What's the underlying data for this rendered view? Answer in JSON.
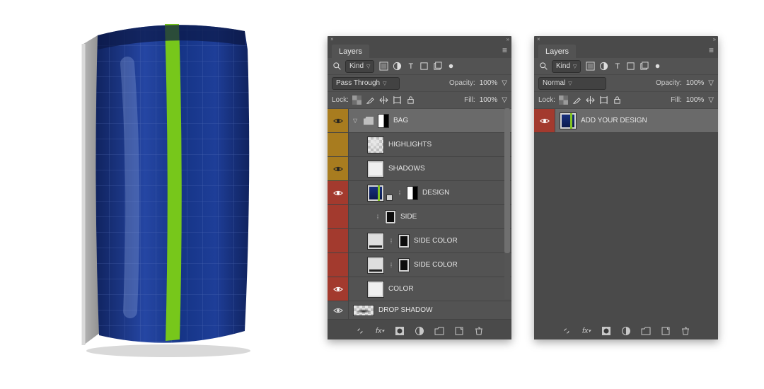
{
  "panel_title": "Layers",
  "filter": {
    "search_placeholder": "Kind",
    "opacity_label": "Opacity:",
    "opacity_value": "100%",
    "lock_label": "Lock:",
    "fill_label": "Fill:",
    "fill_value": "100%"
  },
  "blend_modes": {
    "a": "Pass Through",
    "b": "Normal"
  },
  "left_layers": [
    {
      "name": "BAG",
      "vis": "gold",
      "selected": true,
      "folder": true
    },
    {
      "name": "HIGHLIGHTS",
      "vis": "gold"
    },
    {
      "name": "SHADOWS",
      "vis": "gold"
    },
    {
      "name": "DESIGN",
      "vis": "red"
    },
    {
      "name": "SIDE",
      "vis": "red"
    },
    {
      "name": "SIDE COLOR",
      "vis": "red"
    },
    {
      "name": "SIDE COLOR",
      "vis": "red"
    },
    {
      "name": "COLOR",
      "vis": "red"
    },
    {
      "name": "DROP SHADOW",
      "vis": "grey",
      "small": true
    }
  ],
  "right_layers": [
    {
      "name": "ADD YOUR DESIGN",
      "vis": "red",
      "selected": true
    }
  ],
  "icons": {
    "search": "search-icon",
    "image": "image-icon",
    "adjust": "adjustments-icon",
    "type": "type-icon",
    "shape": "shape-icon",
    "smart": "smart-object-icon",
    "link": "link-icon",
    "fx": "fx-icon",
    "mask": "mask-icon",
    "fill": "fill-adjust-icon",
    "group": "group-icon",
    "new": "new-layer-icon",
    "trash": "trash-icon",
    "lock": "lock-icon",
    "brush": "brush-icon",
    "move": "move-icon",
    "frame": "frame-icon",
    "checker": "transparency-icon"
  }
}
